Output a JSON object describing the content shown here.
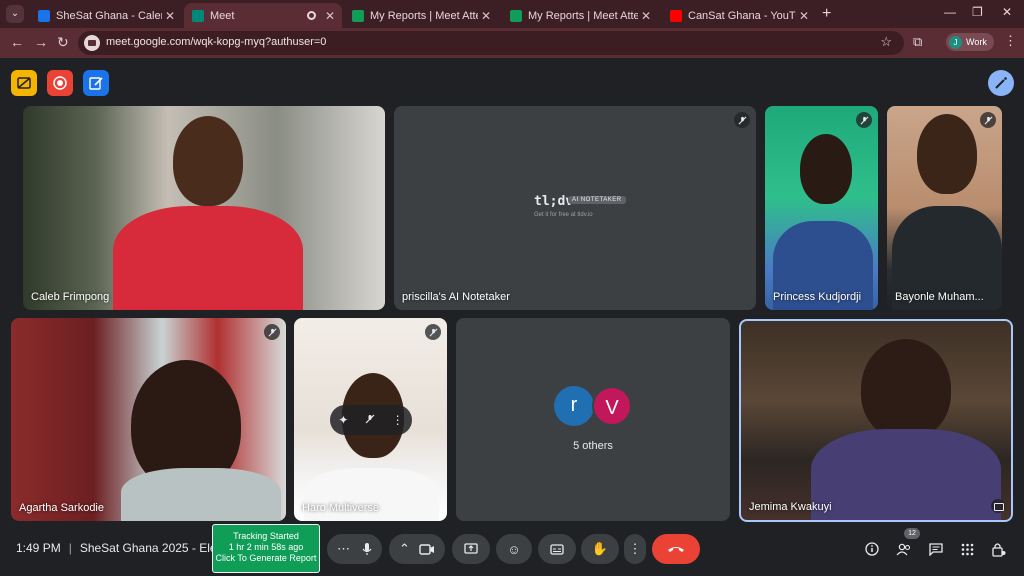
{
  "browser": {
    "tabs": [
      {
        "title": "SheSat Ghana - Calendar - Wee",
        "favicon": "calendar-icon",
        "color": "#1a73e8"
      },
      {
        "title": "Meet",
        "favicon": "meet-icon",
        "color": "#00897b"
      },
      {
        "title": "My Reports | Meet Attendance",
        "favicon": "check-icon",
        "color": "#0f9d58"
      },
      {
        "title": "My Reports | Meet Attendance",
        "favicon": "check-icon",
        "color": "#0f9d58"
      },
      {
        "title": "CanSat Ghana - YouTube",
        "favicon": "youtube-icon",
        "color": "#ff0000"
      }
    ],
    "url": "meet.google.com/wqk-kopg-myq?authuser=0",
    "profile_initial": "J",
    "profile_label": "Work"
  },
  "tiles": {
    "caleb": "Caleb Frimpong",
    "tldv": "priscilla's AI Notetaker",
    "princess": "Princess Kudjordji",
    "bayonle": "Bayonle Muham...",
    "agartha": "Agartha Sarkodie",
    "haro": "Haro Multiverse",
    "jemima": "Jemima Kwakuyi"
  },
  "tldv": {
    "logo": "tl;dv",
    "badge": "AI NOTETAKER",
    "sub": "Get it for free at tldv.io"
  },
  "others": {
    "avatar1": "r",
    "avatar2": "V",
    "label": "5 others"
  },
  "bottom": {
    "time": "1:49 PM",
    "meeting": "SheSat Ghana 2025 - Ele...",
    "tracker_line1": "Tracking Started",
    "tracker_line2": "1 hr 2 min 58s ago",
    "tracker_line3": "Click To Generate Report",
    "participant_count": "12"
  },
  "colors": {
    "accent": "#8ab4f8",
    "end_call": "#ea4335",
    "tracker": "#0f9d58"
  }
}
